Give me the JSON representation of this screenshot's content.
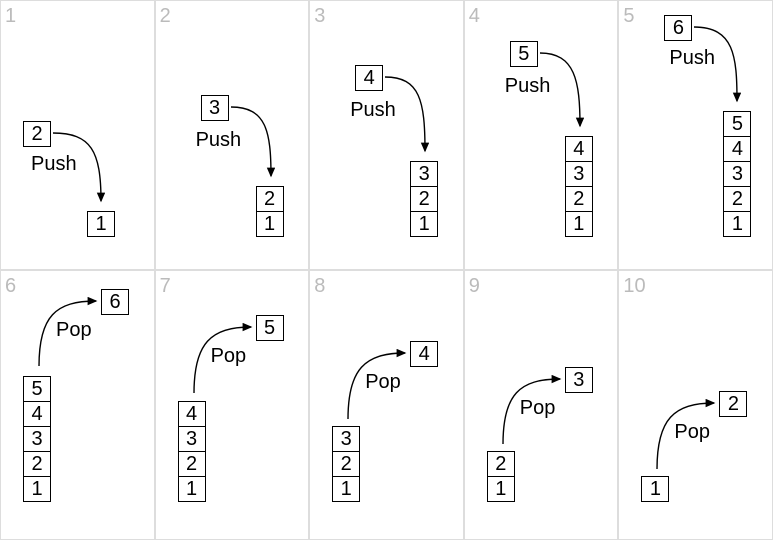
{
  "diagram": {
    "panels": [
      {
        "num": "1",
        "op": "Push",
        "moving": "2",
        "stack": [
          "1"
        ]
      },
      {
        "num": "2",
        "op": "Push",
        "moving": "3",
        "stack": [
          "2",
          "1"
        ]
      },
      {
        "num": "3",
        "op": "Push",
        "moving": "4",
        "stack": [
          "3",
          "2",
          "1"
        ]
      },
      {
        "num": "4",
        "op": "Push",
        "moving": "5",
        "stack": [
          "4",
          "3",
          "2",
          "1"
        ]
      },
      {
        "num": "5",
        "op": "Push",
        "moving": "6",
        "stack": [
          "5",
          "4",
          "3",
          "2",
          "1"
        ]
      },
      {
        "num": "6",
        "op": "Pop",
        "moving": "6",
        "stack": [
          "5",
          "4",
          "3",
          "2",
          "1"
        ]
      },
      {
        "num": "7",
        "op": "Pop",
        "moving": "5",
        "stack": [
          "4",
          "3",
          "2",
          "1"
        ]
      },
      {
        "num": "8",
        "op": "Pop",
        "moving": "4",
        "stack": [
          "3",
          "2",
          "1"
        ]
      },
      {
        "num": "9",
        "op": "Pop",
        "moving": "3",
        "stack": [
          "2",
          "1"
        ]
      },
      {
        "num": "10",
        "op": "Pop",
        "moving": "2",
        "stack": [
          "1"
        ]
      }
    ]
  }
}
